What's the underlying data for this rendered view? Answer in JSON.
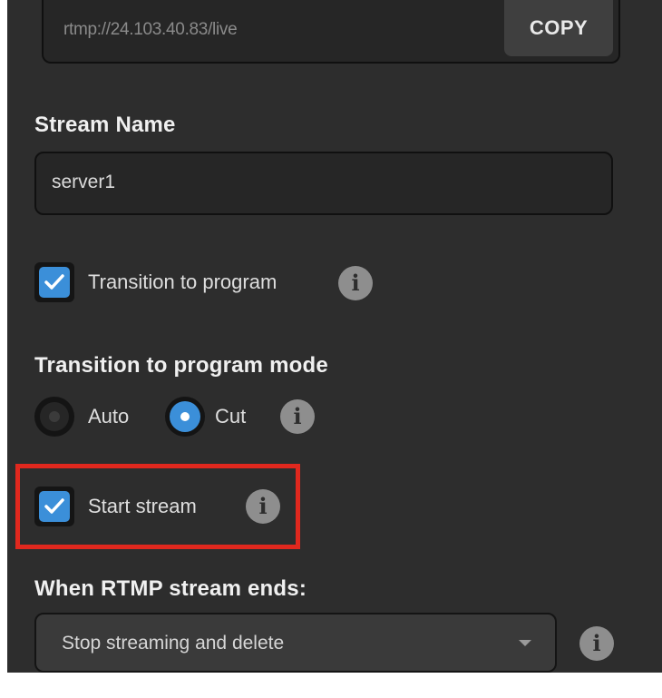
{
  "server": {
    "url_value": "rtmp://24.103.40.83/live",
    "copy_label": "COPY"
  },
  "stream_name": {
    "label": "Stream Name",
    "value": "server1"
  },
  "transition_to_program": {
    "label": "Transition to program",
    "checked": true,
    "info_icon": "info-icon"
  },
  "transition_mode": {
    "label": "Transition to program mode",
    "options": [
      {
        "label": "Auto",
        "selected": false
      },
      {
        "label": "Cut",
        "selected": true
      }
    ],
    "info_icon": "info-icon"
  },
  "start_stream": {
    "label": "Start stream",
    "checked": true,
    "info_icon": "info-icon",
    "highlight_color": "#e0281e"
  },
  "rtmp_end": {
    "label": "When RTMP stream ends:",
    "selected_option": "Stop streaming and delete",
    "info_icon": "info-icon"
  },
  "colors": {
    "panel_bg": "#2d2d2d",
    "accent": "#3b8fd9",
    "field_bg": "#262626"
  },
  "info_glyph": "i"
}
